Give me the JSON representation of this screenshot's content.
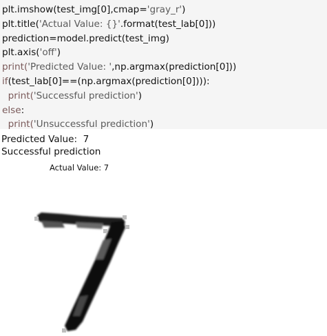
{
  "code_cell": {
    "lines": [
      {
        "parts": [
          {
            "t": "plt.imshow(test_img[0],cmap=",
            "c": ""
          },
          {
            "t": "'gray_r'",
            "c": "s"
          },
          {
            "t": ")",
            "c": ""
          }
        ]
      },
      {
        "parts": [
          {
            "t": "plt.title(",
            "c": ""
          },
          {
            "t": "'Actual Value: {}'",
            "c": "s"
          },
          {
            "t": ".format(test_lab[0]))",
            "c": ""
          }
        ]
      },
      {
        "parts": [
          {
            "t": "prediction=model.predict(test_img)",
            "c": ""
          }
        ]
      },
      {
        "parts": [
          {
            "t": "plt.axis(",
            "c": ""
          },
          {
            "t": "'off'",
            "c": "s"
          },
          {
            "t": ")",
            "c": ""
          }
        ]
      },
      {
        "parts": [
          {
            "t": "print(",
            "c": "k"
          },
          {
            "t": "'Predicted Value: '",
            "c": "s"
          },
          {
            "t": ",np.argmax(prediction[0]))",
            "c": ""
          }
        ]
      },
      {
        "parts": [
          {
            "t": "if",
            "c": "k"
          },
          {
            "t": "(test_lab[0]==(np.argmax(prediction[0]))):",
            "c": ""
          }
        ]
      },
      {
        "parts": [
          {
            "t": "  print(",
            "c": "k"
          },
          {
            "t": "'Successful prediction'",
            "c": "s"
          },
          {
            "t": ")",
            "c": ""
          }
        ]
      },
      {
        "parts": [
          {
            "t": "else",
            "c": "k"
          },
          {
            "t": ":",
            "c": ""
          }
        ]
      },
      {
        "parts": [
          {
            "t": "  print(",
            "c": "k"
          },
          {
            "t": "'Unsuccessful prediction'",
            "c": "s"
          },
          {
            "t": ")",
            "c": ""
          }
        ]
      }
    ]
  },
  "output": {
    "predicted_line": "Predicted Value:  7",
    "result_line": "Successful prediction",
    "figure_title": "Actual Value: 7"
  },
  "figure": {
    "colormap": "gray_r",
    "axis": "off"
  }
}
